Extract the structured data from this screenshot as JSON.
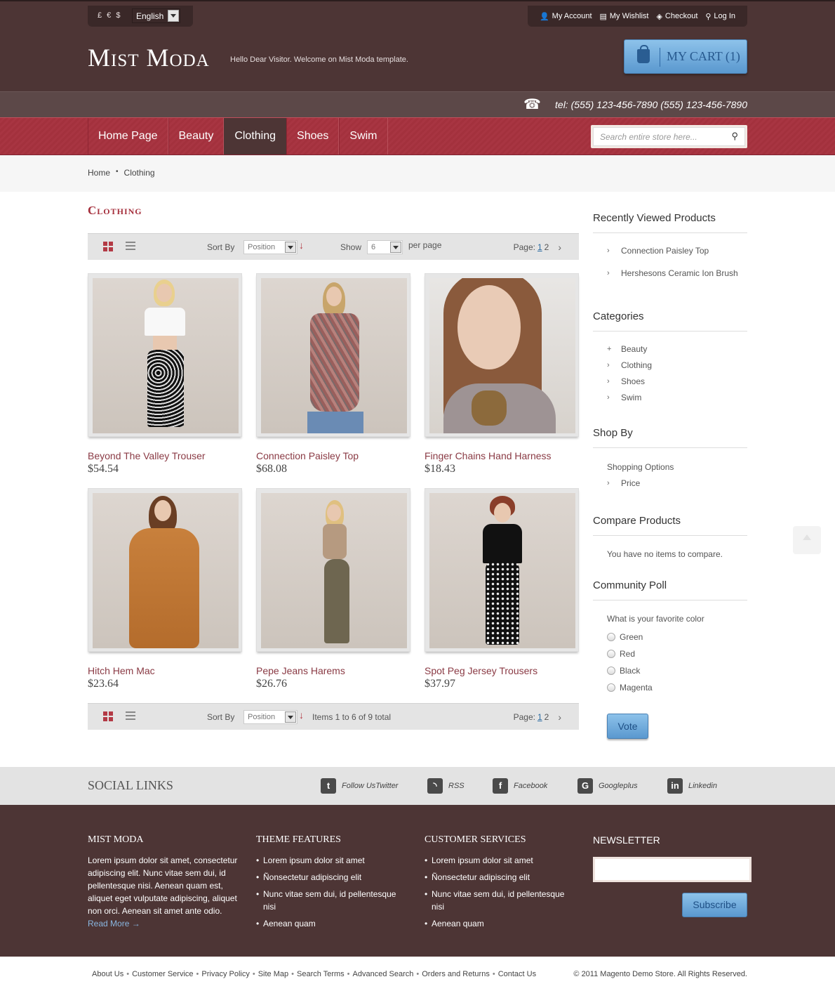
{
  "header": {
    "currencies": "£ € $",
    "language": "English",
    "top_links": [
      {
        "label": "My Account",
        "icon": "user-icon"
      },
      {
        "label": "My Wishlist",
        "icon": "wishlist-icon"
      },
      {
        "label": "Checkout",
        "icon": "tag-icon"
      },
      {
        "label": "Log In",
        "icon": "key-icon"
      }
    ],
    "logo": "Mist Moda",
    "welcome": "Hello Dear Visitor. Welcome on Mist Moda template.",
    "cart_label": "MY CART (1)",
    "phone": "tel: (555) 123-456-7890 (555) 123-456-7890"
  },
  "nav": {
    "items": [
      "Home Page",
      "Beauty",
      "Clothing",
      "Shoes",
      "Swim"
    ],
    "active": "Clothing",
    "search_placeholder": "Search entire store here..."
  },
  "breadcrumb": {
    "home": "Home",
    "current": "Clothing"
  },
  "main": {
    "title": "Clothing",
    "toolbar_top": {
      "sort_label": "Sort By",
      "sort_value": "Position",
      "show_label": "Show",
      "show_value": "6",
      "per_page": "per page",
      "page_label": "Page:",
      "page_current": "1",
      "page_other": "2"
    },
    "toolbar_bottom": {
      "sort_label": "Sort By",
      "sort_value": "Position",
      "items_text": "Items 1 to 6 of 9 total",
      "page_label": "Page:",
      "page_current": "1",
      "page_other": "2"
    },
    "products": [
      {
        "name": "Beyond The Valley Trouser",
        "price": "$54.54"
      },
      {
        "name": "Connection Paisley Top",
        "price": "$68.08"
      },
      {
        "name": "Finger Chains Hand Harness",
        "price": "$18.43"
      },
      {
        "name": "Hitch Hem Mac",
        "price": "$23.64"
      },
      {
        "name": "Pepe Jeans Harems",
        "price": "$26.76"
      },
      {
        "name": "Spot Peg Jersey Trousers",
        "price": "$37.97"
      }
    ]
  },
  "sidebar": {
    "recent_title": "Recently Viewed Products",
    "recent": [
      "Connection Paisley Top",
      "Hershesons Ceramic Ion Brush"
    ],
    "categories_title": "Categories",
    "categories": [
      "Beauty",
      "Clothing",
      "Shoes",
      "Swim"
    ],
    "shopby_title": "Shop By",
    "shopby_sub": "Shopping Options",
    "shopby_item": "Price",
    "compare_title": "Compare Products",
    "compare_text": "You have no items to compare.",
    "poll_title": "Community Poll",
    "poll_question": "What is your favorite color",
    "poll_options": [
      "Green",
      "Red",
      "Black",
      "Magenta"
    ],
    "vote_label": "Vote"
  },
  "social": {
    "title": "SOCIAL LINKS",
    "links": [
      {
        "label": "Follow UsTwitter",
        "icon": "twitter-icon",
        "glyph": "t"
      },
      {
        "label": "RSS",
        "icon": "rss-icon",
        "glyph": "◝"
      },
      {
        "label": "Facebook",
        "icon": "facebook-icon",
        "glyph": "f"
      },
      {
        "label": "Googleplus",
        "icon": "googleplus-icon",
        "glyph": "G"
      },
      {
        "label": "Linkedin",
        "icon": "linkedin-icon",
        "glyph": "in"
      }
    ]
  },
  "footer": {
    "about_title": "MIST MODA",
    "about_text": "Lorem ipsum dolor sit amet, consectetur adipiscing elit. Nunc vitae sem dui, id pellentesque nisi. Aenean quam est, aliquet eget vulputate adipiscing, aliquet non orci. Aenean sit amet ante odio.",
    "read_more": "Read More →",
    "features_title": "THEME FEATURES",
    "features": [
      "Lorem ipsum dolor sit amet",
      "Ñonsectetur adipiscing elit",
      "Nunc vitae sem dui, id pellentesque nisi",
      "Aenean quam"
    ],
    "services_title": "CUSTOMER SERVICES",
    "services": [
      "Lorem ipsum dolor sit amet",
      "Ñonsectetur adipiscing elit",
      "Nunc vitae sem dui, id pellentesque nisi",
      "Aenean quam"
    ],
    "newsletter_title": "NEWSLETTER",
    "subscribe_label": "Subscribe"
  },
  "bottom": {
    "links": [
      "About Us",
      "Customer Service",
      "Privacy Policy",
      "Site Map",
      "Search Terms",
      "Advanced Search",
      "Orders and Returns",
      "Contact Us"
    ],
    "copyright": "© 2011 Magento Demo Store. All Rights Reserved."
  },
  "colors": {
    "brown": "#4d3535",
    "red": "#a83542",
    "blue": "#5a98cf",
    "accent_text": "#a52f3c"
  }
}
